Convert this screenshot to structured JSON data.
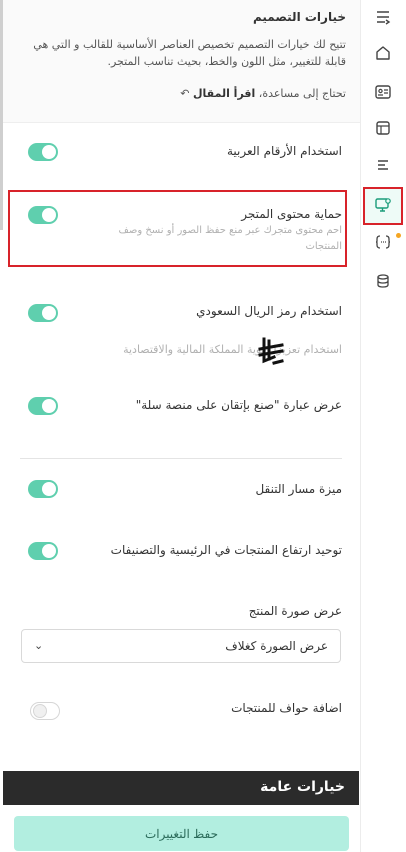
{
  "header": {
    "title": "خيارات التصميم",
    "description": "تتيح لك خيارات التصميم تخصيص العناصر الأساسية للقالب و التي هي قابلة للتغيير، مثل اللون والخط، بحيث تناسب المتجر.",
    "help_prefix": "تحتاج إلى مساعدة،",
    "help_link": "اقرأ المقال"
  },
  "options": {
    "arabic_numbers": {
      "label": "استخدام الأرقام العربية",
      "enabled": true
    },
    "content_protection": {
      "label": "حماية محتوى المتجر",
      "hint_line1": "احم محتوى متجرك عبر منع حفظ الصور أو نسخ وصف",
      "hint_line2": "المنتجات",
      "enabled": true
    },
    "riyal_symbol": {
      "label": "استخدام رمز الريال السعودي",
      "hint": "استخدام   تعزيزًا لهوية المملكة المالية والاقتصادية",
      "enabled": true
    },
    "made_with_salla": {
      "label": "عرض عبارة \"صنع بإتقان على منصة سلة\"",
      "enabled": true
    },
    "breadcrumb": {
      "label": "ميزة مسار التنقل",
      "enabled": true
    },
    "unify_heights": {
      "label": "توحيد ارتفاع المنتجات في الرئيسية والتصنيفات",
      "enabled": true
    },
    "product_image": {
      "label": "عرض صورة المنتج",
      "selected": "عرض الصورة كغلاف"
    },
    "product_borders": {
      "label": "اضافة حواف للمنتجات",
      "enabled": false
    }
  },
  "general_section": {
    "title": "خيارات عامة"
  },
  "footer": {
    "save_label": "حفظ التغييرات"
  },
  "rail": {
    "icons": [
      "menu-align-icon",
      "home-icon",
      "id-card-icon",
      "layout-icon",
      "list-icon",
      "monitor-settings-icon",
      "code-braces-icon",
      "database-icon"
    ],
    "active": "monitor-settings-icon"
  },
  "colors": {
    "accent": "#5fcfae",
    "highlight": "#d8232a",
    "save_bg": "#b2eee0",
    "section_bg": "#2b2b2b"
  }
}
